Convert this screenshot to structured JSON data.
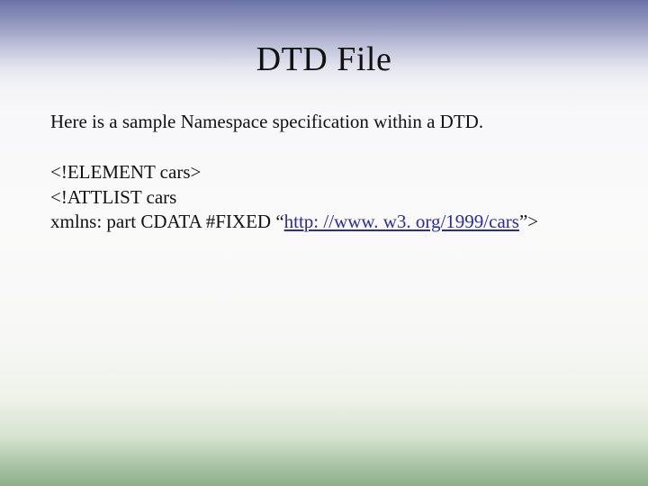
{
  "title": "DTD File",
  "intro": "Here is a sample Namespace specification within a DTD.",
  "code": {
    "line1": "<!ELEMENT  cars>",
    "line2": "<!ATTLIST cars",
    "line3_prefix": "xmlns: part  CDATA #FIXED “",
    "line3_url": "http: //www. w3. org/1999/cars",
    "line3_suffix": "”>"
  }
}
